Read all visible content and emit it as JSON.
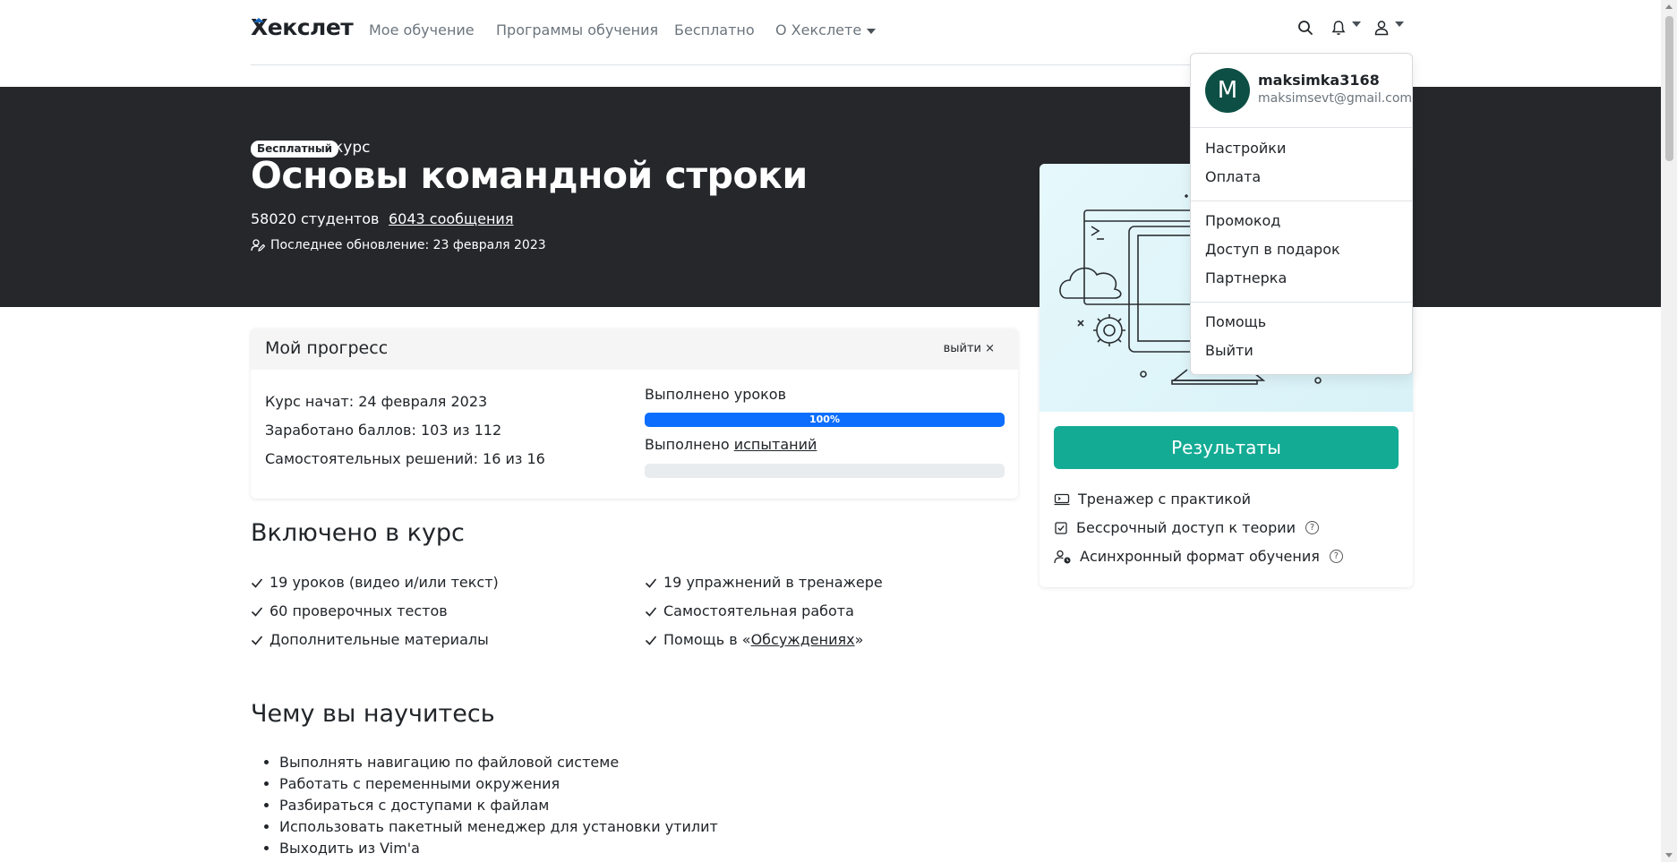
{
  "nav": {
    "brand": "Хекслет",
    "links": [
      "Мое обучение",
      "Программы обучения",
      "Бесплатно",
      "О Хекслете"
    ]
  },
  "hero": {
    "badge": "Бесплатный",
    "course_word": "курс",
    "title": "Основы командной строки",
    "students": "58020 студентов",
    "messages": "6043 сообщения",
    "updated": "Последнее обновление: 23 февраля 2023"
  },
  "progress": {
    "title": "Мой прогресс",
    "exit": "выйти ×",
    "started": "Курс начат: 24 февраля 2023",
    "points": "Заработано баллов: 103 из 112",
    "solutions": "Самостоятельных решений: 16 из 16",
    "lessons_label": "Выполнено уроков",
    "lessons_percent": "100%",
    "lessons_fraction": 1.0,
    "tests_label_prefix": "Выполнено ",
    "tests_label_link": "испытаний",
    "tests_fraction": 0.0
  },
  "included": {
    "heading": "Включено в курс",
    "left": [
      "19 уроков (видео и/или текст)",
      "60 проверочных тестов",
      "Дополнительные материалы"
    ],
    "right": [
      "19 упражнений в тренажере",
      "Самостоятельная работа"
    ],
    "help_prefix": "Помощь в «",
    "help_link": "Обсуждениях",
    "help_suffix": "»"
  },
  "learn": {
    "heading": "Чему вы научитесь",
    "items": [
      "Выполнять навигацию по файловой системе",
      "Работать с переменными окружения",
      "Разбираться с доступами к файлам",
      "Использовать пакетный менеджер для установки утилит",
      "Выходить из Vim'a"
    ]
  },
  "side": {
    "results_button": "Результаты",
    "features": [
      {
        "icon": "trainer-icon",
        "label": "Тренажер с практикой"
      },
      {
        "icon": "checkbox-icon",
        "label": "Бессрочный доступ к теории"
      },
      {
        "icon": "user-clock-icon",
        "label": "Асинхронный формат обучения"
      }
    ]
  },
  "user_menu": {
    "avatar_letter": "M",
    "username": "maksimka3168",
    "email": "maksimsevt@gmail.com",
    "group1": [
      "Настройки",
      "Оплата"
    ],
    "group2": [
      "Промокод",
      "Доступ в подарок",
      "Партнерка"
    ],
    "group3": [
      "Помощь",
      "Выйти"
    ]
  },
  "colors": {
    "hero_bg": "#25272b",
    "progress_bar": "#0d6efd",
    "results_button": "#14ab95",
    "avatar_bg": "#0e4f45"
  }
}
